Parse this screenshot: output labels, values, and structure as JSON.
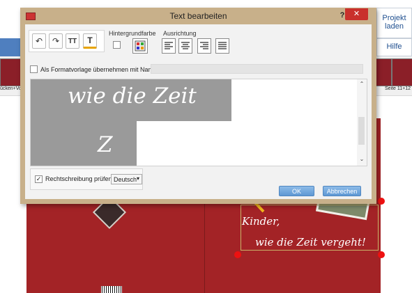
{
  "app": {
    "right_buttons": {
      "load_project": "Projekt\nladen",
      "help": "Hilfe"
    },
    "thumbnails": {
      "left_caption": "ücken+Vo",
      "right_caption": "Seite 11+12"
    },
    "book_text": {
      "line1": "Kinder,",
      "line2": "wie die Zeit vergeht!"
    },
    "accent": "#a32326"
  },
  "dialog": {
    "title": "Text bearbeiten",
    "help_label": "?",
    "close_label": "✕",
    "toolbar": {
      "background_label": "Hintergrundfarbe",
      "alignment_label": "Ausrichtung",
      "undo_glyph": "↶",
      "redo_glyph": "↷",
      "font_size_glyph": "TT",
      "font_color_glyph": "T"
    },
    "format_template": {
      "label": "Als Formatvorlage übernehmen mit Namen:",
      "value": ""
    },
    "editor": {
      "line1": "wie die Zeit",
      "line2": "Z"
    },
    "spellcheck": {
      "label": "Rechtschreibung prüfen",
      "checked": true,
      "language": "Deutsch"
    },
    "ok_label": "OK",
    "cancel_label": "Abbrechen"
  }
}
